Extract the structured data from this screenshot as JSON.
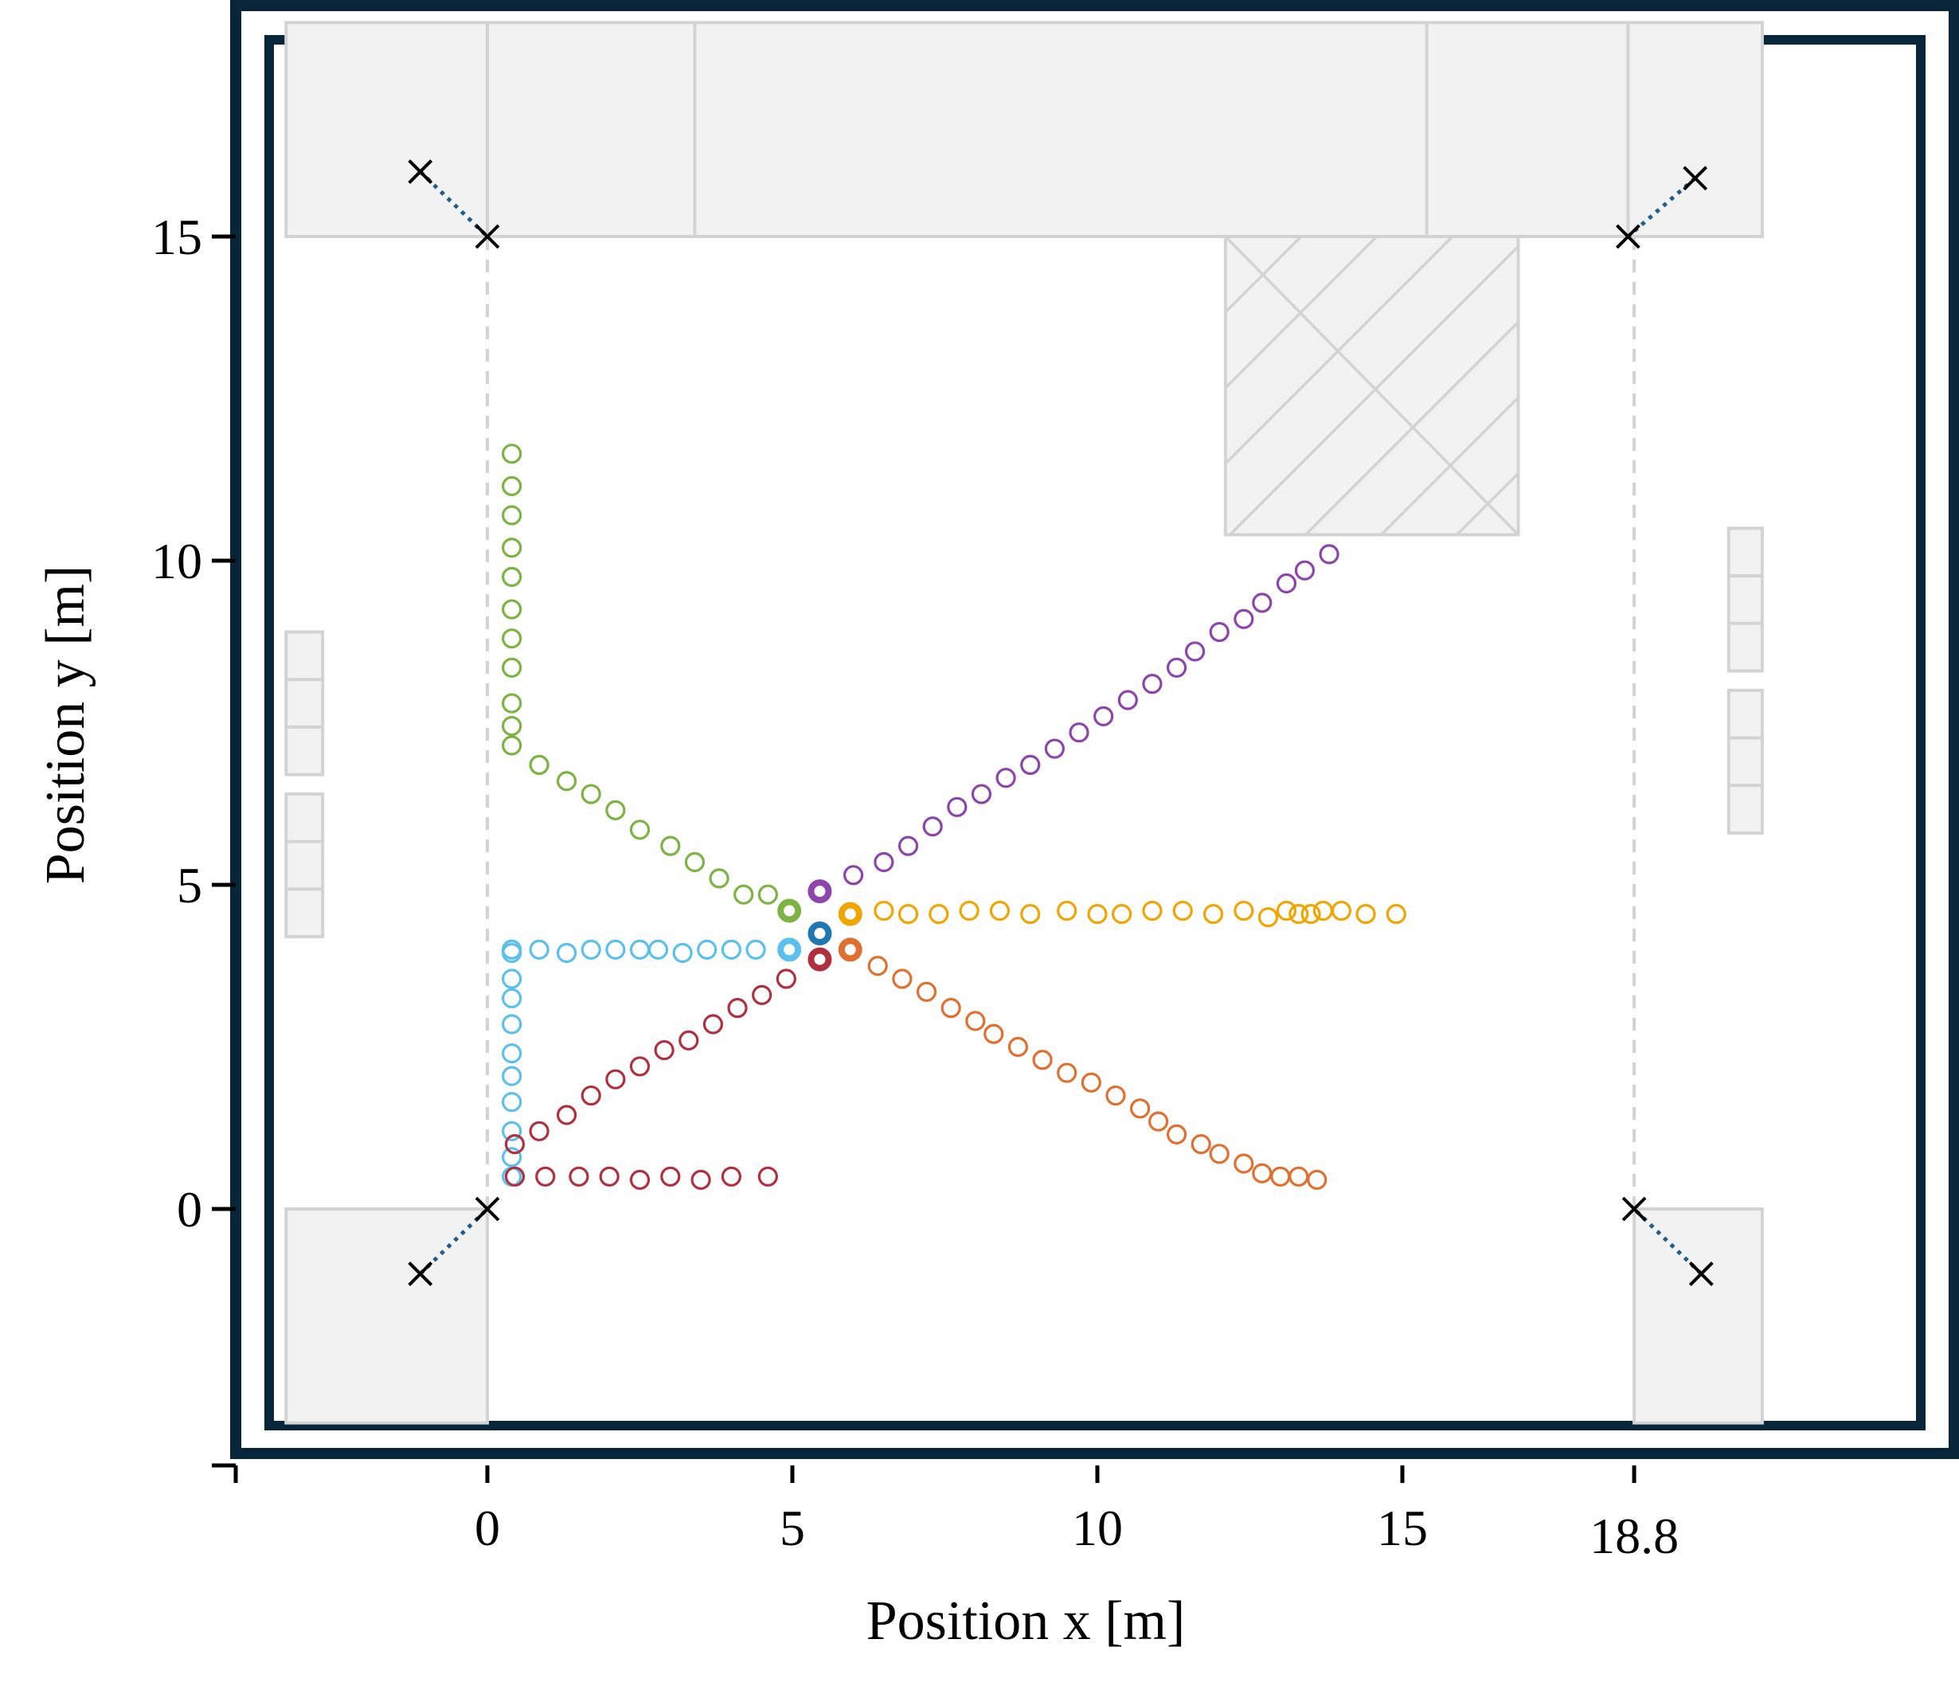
{
  "chart_data": {
    "type": "scatter",
    "title": "",
    "xlabel": "Position x [m]",
    "ylabel": "Position y [m]",
    "xlim": [
      -3.9,
      21.3
    ],
    "ylim": [
      -4.1,
      18.3
    ],
    "xticks": [
      0,
      5,
      10,
      15,
      18.8
    ],
    "yticks": [
      0,
      5,
      10,
      15
    ],
    "xtick_labels": [
      "0",
      "5",
      "10",
      "15",
      "18.8"
    ],
    "ytick_labels": [
      "0",
      "5",
      "10",
      "15"
    ],
    "grid": false,
    "legend": "none",
    "colors": {
      "frame": "#08263a",
      "zone_fill": "#f2f2f2",
      "zone_stroke": "#d3d3d3",
      "anchor": "#000000",
      "anchor_link": "#1f5f8b"
    },
    "building": {
      "walls": [
        {
          "x0": -3.3,
          "y0": 15.0,
          "x1": 20.9,
          "y1": 18.3
        },
        {
          "x0": -3.3,
          "y0": -3.3,
          "x1": 0.0,
          "y1": 0.0
        },
        {
          "x0": 18.8,
          "y0": -3.3,
          "x1": 20.9,
          "y1": 0.0
        }
      ],
      "wall_dividers": [
        {
          "x0": 0.0,
          "y0": 15.0,
          "x1": 0.0,
          "y1": 18.3
        },
        {
          "x0": 3.4,
          "y0": 15.0,
          "x1": 3.4,
          "y1": 18.3
        },
        {
          "x0": 15.4,
          "y0": 15.0,
          "x1": 15.4,
          "y1": 18.3
        },
        {
          "x0": 18.7,
          "y0": 15.0,
          "x1": 18.7,
          "y1": 18.3
        }
      ],
      "obstacle": {
        "x0": 12.1,
        "y0": 10.4,
        "x1": 16.9,
        "y1": 15.0
      },
      "shelves": [
        {
          "x0": -3.3,
          "y0": 6.7,
          "x1": -2.7,
          "y1": 8.9,
          "cells": 3
        },
        {
          "x0": -3.3,
          "y0": 4.2,
          "x1": -2.7,
          "y1": 6.4,
          "cells": 3
        },
        {
          "x0": 20.35,
          "y0": 8.3,
          "x1": 20.9,
          "y1": 10.5,
          "cells": 3
        },
        {
          "x0": 20.35,
          "y0": 5.8,
          "x1": 20.9,
          "y1": 8.0,
          "cells": 3
        }
      ],
      "guide_lines": [
        {
          "x0": 0.0,
          "y0": 0.0,
          "x1": 0.0,
          "y1": 15.0
        },
        {
          "x0": 18.8,
          "y0": 0.0,
          "x1": 18.8,
          "y1": 15.0
        }
      ]
    },
    "anchors": [
      {
        "x": -1.1,
        "y": 16.0,
        "link_to": [
          0.0,
          15.0
        ]
      },
      {
        "x": 0.0,
        "y": 15.0
      },
      {
        "x": 19.8,
        "y": 15.9,
        "link_to": [
          18.7,
          15.0
        ]
      },
      {
        "x": 18.7,
        "y": 15.0
      },
      {
        "x": -1.1,
        "y": -1.0,
        "link_to": [
          0.0,
          0.0
        ]
      },
      {
        "x": 0.0,
        "y": 0.0
      },
      {
        "x": 19.9,
        "y": -1.0,
        "link_to": [
          18.8,
          0.0
        ]
      },
      {
        "x": 18.8,
        "y": 0.0
      }
    ],
    "series": [
      {
        "color": "#7cb342",
        "start": {
          "x": 4.95,
          "y": 4.6
        },
        "x": [
          0.4,
          0.4,
          0.4,
          0.4,
          0.4,
          0.4,
          0.4,
          0.4,
          0.4,
          0.4,
          0.4,
          0.85,
          1.3,
          1.7,
          2.1,
          2.5,
          3.0,
          3.4,
          3.8,
          4.2,
          4.6
        ],
        "y": [
          11.65,
          11.15,
          10.7,
          10.2,
          9.75,
          9.25,
          8.8,
          8.35,
          7.8,
          7.45,
          7.15,
          6.85,
          6.6,
          6.4,
          6.15,
          5.85,
          5.6,
          5.35,
          5.1,
          4.85,
          4.85
        ]
      },
      {
        "color": "#8e44ad",
        "start": {
          "x": 5.45,
          "y": 4.9
        },
        "x": [
          6.0,
          6.5,
          6.9,
          7.3,
          7.7,
          8.1,
          8.5,
          8.9,
          9.3,
          9.7,
          10.1,
          10.5,
          10.9,
          11.3,
          11.6,
          12.0,
          12.4,
          12.7,
          13.1,
          13.4,
          13.8
        ],
        "y": [
          5.15,
          5.35,
          5.6,
          5.9,
          6.2,
          6.4,
          6.65,
          6.85,
          7.1,
          7.35,
          7.6,
          7.85,
          8.1,
          8.35,
          8.6,
          8.9,
          9.1,
          9.35,
          9.65,
          9.85,
          10.1
        ]
      },
      {
        "color": "#f0a500",
        "start": {
          "x": 5.95,
          "y": 4.55
        },
        "x": [
          6.5,
          6.9,
          7.4,
          7.9,
          8.4,
          8.9,
          9.5,
          10.0,
          10.4,
          10.9,
          11.4,
          11.9,
          12.4,
          12.8,
          13.1,
          13.3,
          13.5,
          13.7,
          14.0,
          14.4,
          14.9
        ],
        "y": [
          4.6,
          4.55,
          4.55,
          4.6,
          4.6,
          4.55,
          4.6,
          4.55,
          4.55,
          4.6,
          4.6,
          4.55,
          4.6,
          4.5,
          4.6,
          4.55,
          4.55,
          4.6,
          4.6,
          4.55,
          4.55
        ]
      },
      {
        "color": "#e07030",
        "start": {
          "x": 5.95,
          "y": 4.0
        },
        "x": [
          6.4,
          6.8,
          7.2,
          7.6,
          8.0,
          8.3,
          8.7,
          9.1,
          9.5,
          9.9,
          10.3,
          10.7,
          11.0,
          11.3,
          11.7,
          12.0,
          12.4,
          12.7,
          13.0,
          13.3,
          13.6
        ],
        "y": [
          3.75,
          3.55,
          3.35,
          3.1,
          2.9,
          2.7,
          2.5,
          2.3,
          2.1,
          1.95,
          1.75,
          1.55,
          1.35,
          1.15,
          1.0,
          0.85,
          0.7,
          0.55,
          0.5,
          0.5,
          0.45
        ]
      },
      {
        "color": "#1f77b4",
        "start": {
          "x": 5.45,
          "y": 4.25
        },
        "x": [],
        "y": []
      },
      {
        "color": "#5bc0eb",
        "start": {
          "x": 4.95,
          "y": 4.0
        },
        "x": [
          0.4,
          0.4,
          0.4,
          0.4,
          0.4,
          0.4,
          0.4,
          0.4,
          0.4,
          0.4,
          0.4,
          0.4,
          0.85,
          1.3,
          1.7,
          2.1,
          2.5,
          2.8,
          3.2,
          3.6,
          4.0,
          4.4
        ],
        "y": [
          0.5,
          0.8,
          1.2,
          1.65,
          2.05,
          2.4,
          2.85,
          3.25,
          3.55,
          3.95,
          4.0,
          4.0,
          4.0,
          3.95,
          4.0,
          4.0,
          4.0,
          4.0,
          3.95,
          4.0,
          4.0,
          4.0
        ]
      },
      {
        "color": "#b03040",
        "start": {
          "x": 5.45,
          "y": 3.85
        },
        "x": [
          0.45,
          0.85,
          1.3,
          1.7,
          2.1,
          2.5,
          2.9,
          3.3,
          3.7,
          4.1,
          4.5,
          4.9
        ],
        "y": [
          1.0,
          1.2,
          1.45,
          1.75,
          2.0,
          2.2,
          2.45,
          2.6,
          2.85,
          3.1,
          3.3,
          3.55
        ]
      },
      {
        "color": "#b03040",
        "x": [
          0.45,
          0.95,
          1.5,
          2.0,
          2.5,
          3.0,
          3.5,
          4.0,
          4.6
        ],
        "y": [
          0.5,
          0.5,
          0.5,
          0.5,
          0.45,
          0.5,
          0.45,
          0.5,
          0.5
        ]
      }
    ]
  }
}
